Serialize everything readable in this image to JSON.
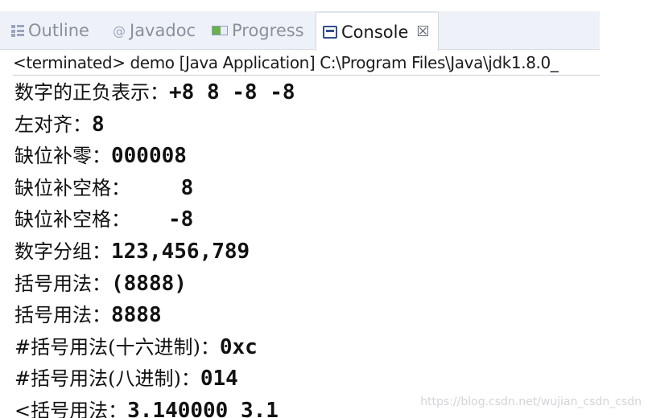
{
  "tabs": {
    "outline": {
      "label": "Outline",
      "icon": "outline-icon"
    },
    "javadoc": {
      "label": "Javadoc",
      "icon": "javadoc-icon",
      "glyph": "@"
    },
    "progress": {
      "label": "Progress",
      "icon": "progress-icon"
    },
    "console": {
      "label": "Console",
      "icon": "console-icon",
      "close_glyph": "☒"
    }
  },
  "status": "<terminated> demo [Java Application] C:\\Program Files\\Java\\jdk1.8.0_",
  "console": {
    "lines": [
      {
        "label": "数字的正负表示：",
        "value": "+8 8 -8 -8"
      },
      {
        "label": "左对齐：",
        "value": "8"
      },
      {
        "label": "缺位补零：",
        "value": "000008"
      },
      {
        "label": "缺位补空格：",
        "value": "    8"
      },
      {
        "label": "缺位补空格：",
        "value": "   -8"
      },
      {
        "label": "数字分组：",
        "value": "123,456,789"
      },
      {
        "label": "括号用法：",
        "value": "(8888)"
      },
      {
        "label": "括号用法：",
        "value": "8888"
      },
      {
        "label": "#括号用法(十六进制)：",
        "value": "0xc"
      },
      {
        "label": "#括号用法(八进制)：",
        "value": "014"
      },
      {
        "label": "<括号用法：",
        "value": "3.140000 3.1"
      }
    ]
  },
  "watermark": "https://blog.csdn.net/wujian_csdn_csdn",
  "colors": {
    "tab_bar_bg": "#eef2f8",
    "active_tab_bg": "#ffffff",
    "inactive_tab_text": "#8a9099",
    "text": "#111111"
  }
}
